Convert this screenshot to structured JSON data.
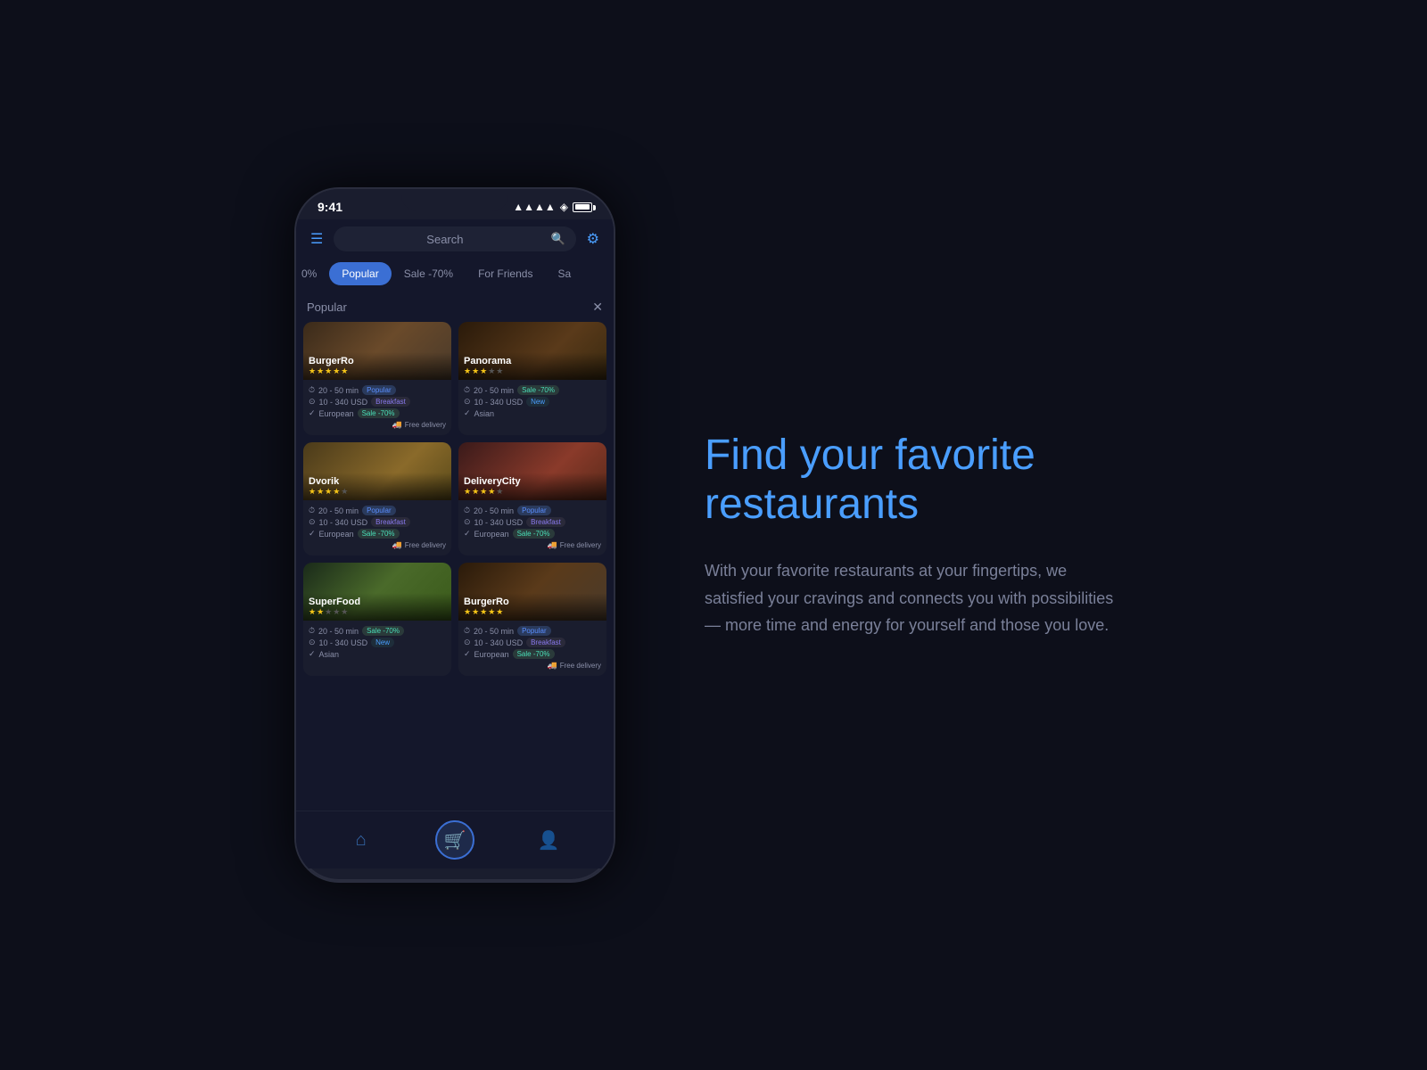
{
  "page": {
    "background": "#0d0f1a"
  },
  "phone": {
    "status_bar": {
      "time": "9:41"
    },
    "header": {
      "search_placeholder": "Search"
    },
    "tabs": [
      {
        "label": "0%",
        "active": false,
        "partial": true
      },
      {
        "label": "Popular",
        "active": true
      },
      {
        "label": "Sale -70%",
        "active": false
      },
      {
        "label": "For Friends",
        "active": false
      },
      {
        "label": "Sa...",
        "active": false,
        "partial": true
      }
    ],
    "popular_label": "Popular",
    "restaurants": [
      {
        "name": "BurgerRo",
        "stars": 5,
        "stars_empty": 0,
        "time": "20 - 50 min",
        "price": "10 - 340 USD",
        "cuisine": "European",
        "badges": [
          "Popular",
          "Breakfast",
          "Sale -70%"
        ],
        "free_delivery": true,
        "image": "burgerro-1"
      },
      {
        "name": "Panorama",
        "stars": 3,
        "stars_empty": 2,
        "time": "20 - 50 min",
        "price": "10 - 340 USD",
        "cuisine": "Asian",
        "badges": [
          "Sale -70%",
          "New"
        ],
        "free_delivery": false,
        "image": "panorama"
      },
      {
        "name": "Dvorik",
        "stars": 4,
        "stars_empty": 1,
        "time": "20 - 50 min",
        "price": "10 - 340 USD",
        "cuisine": "European",
        "badges": [
          "Popular",
          "Breakfast",
          "Sale -70%"
        ],
        "free_delivery": true,
        "image": "dvorik"
      },
      {
        "name": "DeliveryCity",
        "stars": 4,
        "stars_empty": 1,
        "time": "20 - 50 min",
        "price": "10 - 340 USD",
        "cuisine": "European",
        "badges": [
          "Popular",
          "Breakfast",
          "Sale -70%"
        ],
        "free_delivery": true,
        "image": "delivery-city"
      },
      {
        "name": "SuperFood",
        "stars": 2,
        "stars_empty": 3,
        "time": "20 - 50 min",
        "price": "10 - 340 USD",
        "cuisine": "Asian",
        "badges": [
          "Sale -70%",
          "New"
        ],
        "free_delivery": false,
        "image": "superfood"
      },
      {
        "name": "BurgerRo",
        "stars": 5,
        "stars_empty": 0,
        "time": "20 - 50 min",
        "price": "10 - 340 USD",
        "cuisine": "European",
        "badges": [
          "Popular",
          "Breakfast",
          "Sale -70%"
        ],
        "free_delivery": true,
        "image": "burgerro-2"
      }
    ],
    "bottom_nav": [
      {
        "icon": "home",
        "active": false
      },
      {
        "icon": "cart",
        "active": true
      },
      {
        "icon": "profile",
        "active": false
      }
    ]
  },
  "text_panel": {
    "heading": "Find your favorite restaurants",
    "body": "With your favorite restaurants at your fingertips, we satisfied your cravings and connects you with possibilities — more time and energy for yourself and those you love."
  }
}
